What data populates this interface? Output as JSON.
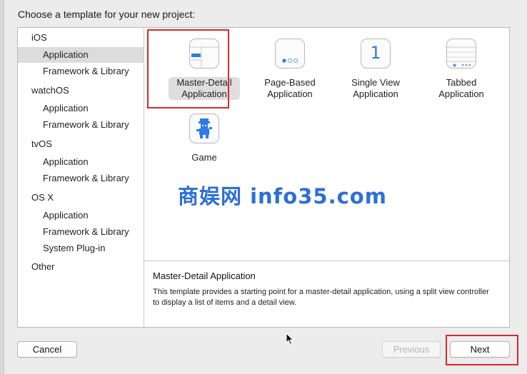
{
  "dialog": {
    "title": "Choose a template for your new project:"
  },
  "sidebar": {
    "sections": [
      {
        "platform": "iOS",
        "items": [
          "Application",
          "Framework & Library"
        ]
      },
      {
        "platform": "watchOS",
        "items": [
          "Application",
          "Framework & Library"
        ]
      },
      {
        "platform": "tvOS",
        "items": [
          "Application",
          "Framework & Library"
        ]
      },
      {
        "platform": "OS X",
        "items": [
          "Application",
          "Framework & Library",
          "System Plug-in"
        ]
      },
      {
        "platform": "Other",
        "items": []
      }
    ],
    "selected": "iOS / Application"
  },
  "templates": [
    {
      "label": "Master-Detail Application",
      "icon": "master-detail-icon",
      "selected": true
    },
    {
      "label": "Page-Based Application",
      "icon": "page-based-icon",
      "selected": false
    },
    {
      "label": "Single View Application",
      "icon": "single-view-icon",
      "icon_text": "1",
      "selected": false
    },
    {
      "label": "Tabbed Application",
      "icon": "tabbed-icon",
      "selected": false
    },
    {
      "label": "Game",
      "icon": "game-icon",
      "selected": false
    }
  ],
  "description": {
    "title": "Master-Detail Application",
    "text": "This template provides a starting point for a master-detail application, using a split view controller to display a list of items and a detail view."
  },
  "buttons": {
    "cancel": "Cancel",
    "previous": "Previous",
    "next": "Next"
  },
  "watermark": "商娱网 info35.com",
  "colors": {
    "highlight_red": "#d62a2a",
    "accent_blue": "#2d6fd6",
    "selection_gray": "#dcdcdc"
  }
}
